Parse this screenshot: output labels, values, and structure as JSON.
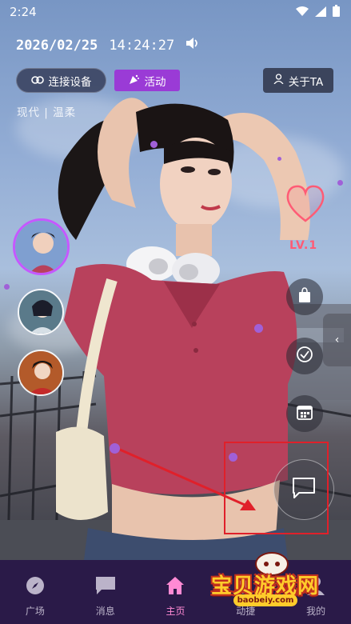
{
  "status_bar": {
    "time": "2:24"
  },
  "header": {
    "date": "2026/02/25",
    "time": "14:24:27",
    "connect_label": "连接设备",
    "activity_label": "活动",
    "about_label": "关于TA",
    "tags": "现代 | 温柔"
  },
  "companion": {
    "level": "LV.1"
  },
  "nav": {
    "items": [
      {
        "label": "广场",
        "icon": "compass-icon"
      },
      {
        "label": "消息",
        "icon": "chat-icon"
      },
      {
        "label": "主页",
        "icon": "home-icon"
      },
      {
        "label": "动捷",
        "icon": "bulb-icon"
      },
      {
        "label": "我的",
        "icon": "user-icon"
      }
    ],
    "active_index": 2
  },
  "watermark": {
    "text": "宝贝游戏网",
    "url": "baobeiy.com"
  },
  "colors": {
    "accent": "#9a3bd6",
    "nav_bg": "#2a1a48",
    "active_nav": "#ff8ad4",
    "heart": "#ff5b75",
    "annotation": "#e0202a"
  }
}
